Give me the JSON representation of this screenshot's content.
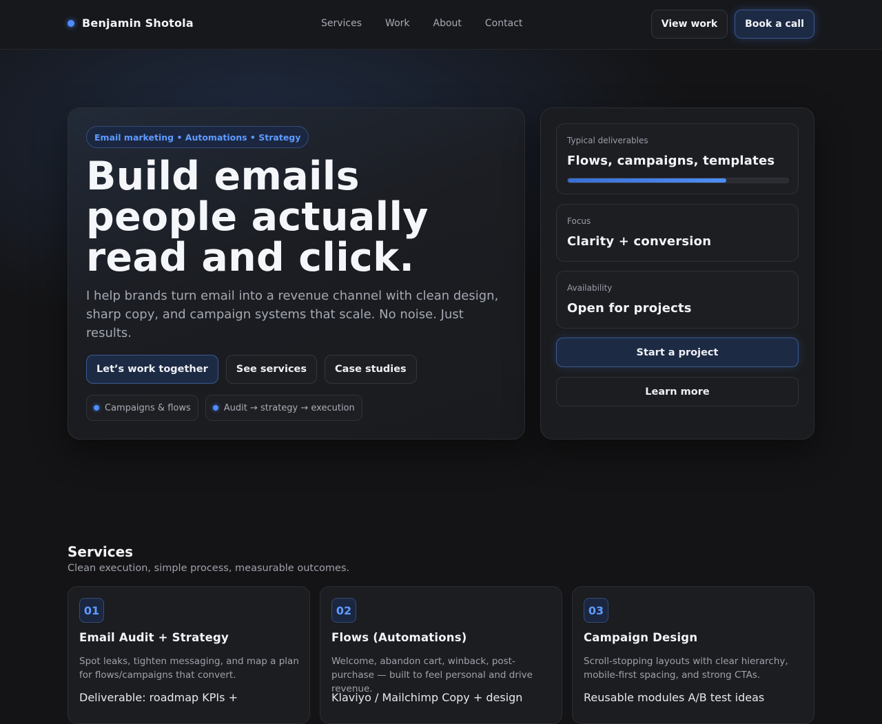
{
  "brand": {
    "name": "Benjamin Shotola"
  },
  "nav": {
    "items": [
      "Services",
      "Work",
      "About",
      "Contact"
    ]
  },
  "header": {
    "view_work": "View work",
    "book_call": "Book a call"
  },
  "hero": {
    "pill": "Email marketing • Automations • Strategy",
    "title": "Build emails people actually read and click.",
    "subtitle": "I help brands turn email into a revenue channel with clean design, sharp copy, and campaign systems that scale. No noise. Just results.",
    "ctas": [
      "Let’s work together",
      "See services",
      "Case studies"
    ],
    "chips": [
      "Campaigns & flows",
      "Audit → strategy → execution"
    ]
  },
  "side": {
    "stats": [
      {
        "label": "Typical deliverables",
        "value": "Flows, campaigns, templates",
        "progress": 0.72
      },
      {
        "label": "Focus",
        "value": "Clarity + conversion"
      },
      {
        "label": "Availability",
        "value": "Open for projects"
      }
    ],
    "primary_btn": "Start a project",
    "secondary_btn": "Learn more"
  },
  "services": {
    "title": "Services",
    "subtitle": "Clean execution, simple process, measurable outcomes.",
    "cards": [
      {
        "num": "01",
        "title": "Email Audit + Strategy",
        "desc": "Spot leaks, tighten messaging, and map a plan for flows/campaigns that convert.",
        "extra": "Deliverable: roadmap KPIs +"
      },
      {
        "num": "02",
        "title": "Flows (Automations)",
        "desc": "Welcome, abandon cart, winback, post-purchase — built to feel personal and drive revenue.",
        "extra": "Klaviyo / Mailchimp Copy + design"
      },
      {
        "num": "03",
        "title": "Campaign Design",
        "desc": "Scroll-stopping layouts with clear hierarchy, mobile-first spacing, and strong CTAs.",
        "extra": "Reusable modules A/B test ideas"
      }
    ]
  },
  "colors": {
    "accent": "#4d8dff",
    "background": "#141416",
    "card": "#1b1c1f"
  }
}
